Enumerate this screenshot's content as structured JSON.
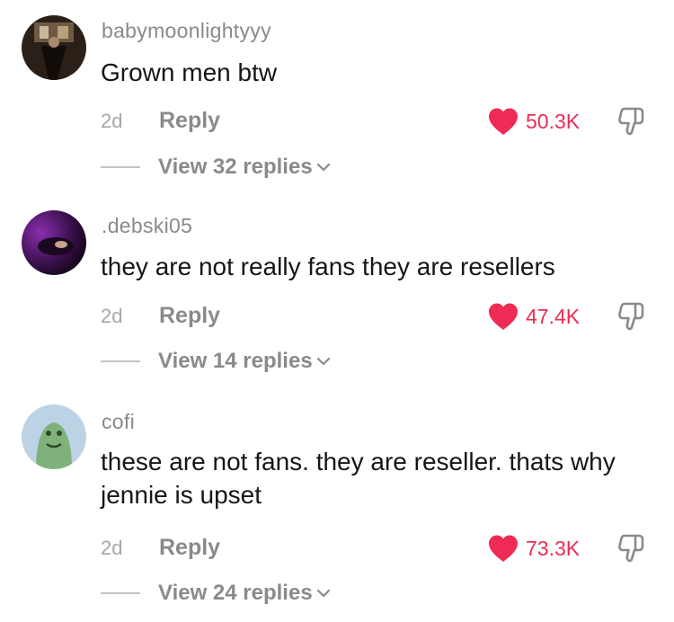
{
  "comments": [
    {
      "username": "babymoonlightyyy",
      "text": "Grown men btw",
      "date": "2d",
      "reply_label": "Reply",
      "likes": "50.3K",
      "view_replies": "View 32 replies"
    },
    {
      "username": ".debski05",
      "text": "they are not really fans they are resellers",
      "date": "2d",
      "reply_label": "Reply",
      "likes": "47.4K",
      "view_replies": "View 14 replies"
    },
    {
      "username": "cofi",
      "text": "these are not fans. they are reseller. thats why jennie is upset",
      "date": "2d",
      "reply_label": "Reply",
      "likes": "73.3K",
      "view_replies": "View 24 replies"
    }
  ],
  "colors": {
    "like_accent": "#ee2b55",
    "secondary_text": "#8a8a8a",
    "primary_text": "#161616"
  },
  "icons": {
    "like": "heart-icon",
    "dislike": "thumbs-down-icon",
    "expand": "chevron-down-icon"
  }
}
